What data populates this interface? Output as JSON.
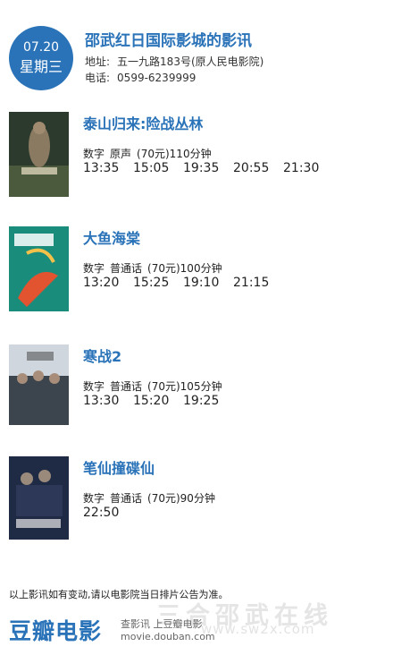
{
  "header": {
    "date": "07.20",
    "weekday": "星期三",
    "cinema_name": "邵武红日国际影城的影讯",
    "address_label": "地址:",
    "address": "五一九路183号(原人民电影院)",
    "phone_label": "电话:",
    "phone": "0599-6239999"
  },
  "movies": [
    {
      "title": "泰山归来:险战丛林",
      "format": "数字",
      "language": "原声",
      "price": "(70元)",
      "duration": "110分钟",
      "times": [
        "13:35",
        "15:05",
        "19:35",
        "20:55",
        "21:30"
      ],
      "poster_color": "#3b4a3c"
    },
    {
      "title": "大鱼海棠",
      "format": "数字",
      "language": "普通话",
      "price": "(70元)",
      "duration": "100分钟",
      "times": [
        "13:20",
        "15:25",
        "19:10",
        "21:15"
      ],
      "poster_color": "#1e8a7a"
    },
    {
      "title": "寒战2",
      "format": "数字",
      "language": "普通话",
      "price": "(70元)",
      "duration": "105分钟",
      "times": [
        "13:30",
        "15:20",
        "19:25"
      ],
      "poster_color": "#5a6470"
    },
    {
      "title": "笔仙撞碟仙",
      "format": "数字",
      "language": "普通话",
      "price": "(70元)",
      "duration": "90分钟",
      "times": [
        "22:50"
      ],
      "poster_color": "#1f2a44"
    }
  ],
  "footer": {
    "notice": "以上影讯如有变动,请以电影院当日排片公告为准。",
    "logo": "豆瓣电影",
    "text": "查影讯 上豆瓣电影",
    "url": "movie.douban.com",
    "watermark": "三合邵武在线",
    "watermark_url": "www.sw2x.com"
  },
  "colors": {
    "accent": "#2a73b8"
  }
}
